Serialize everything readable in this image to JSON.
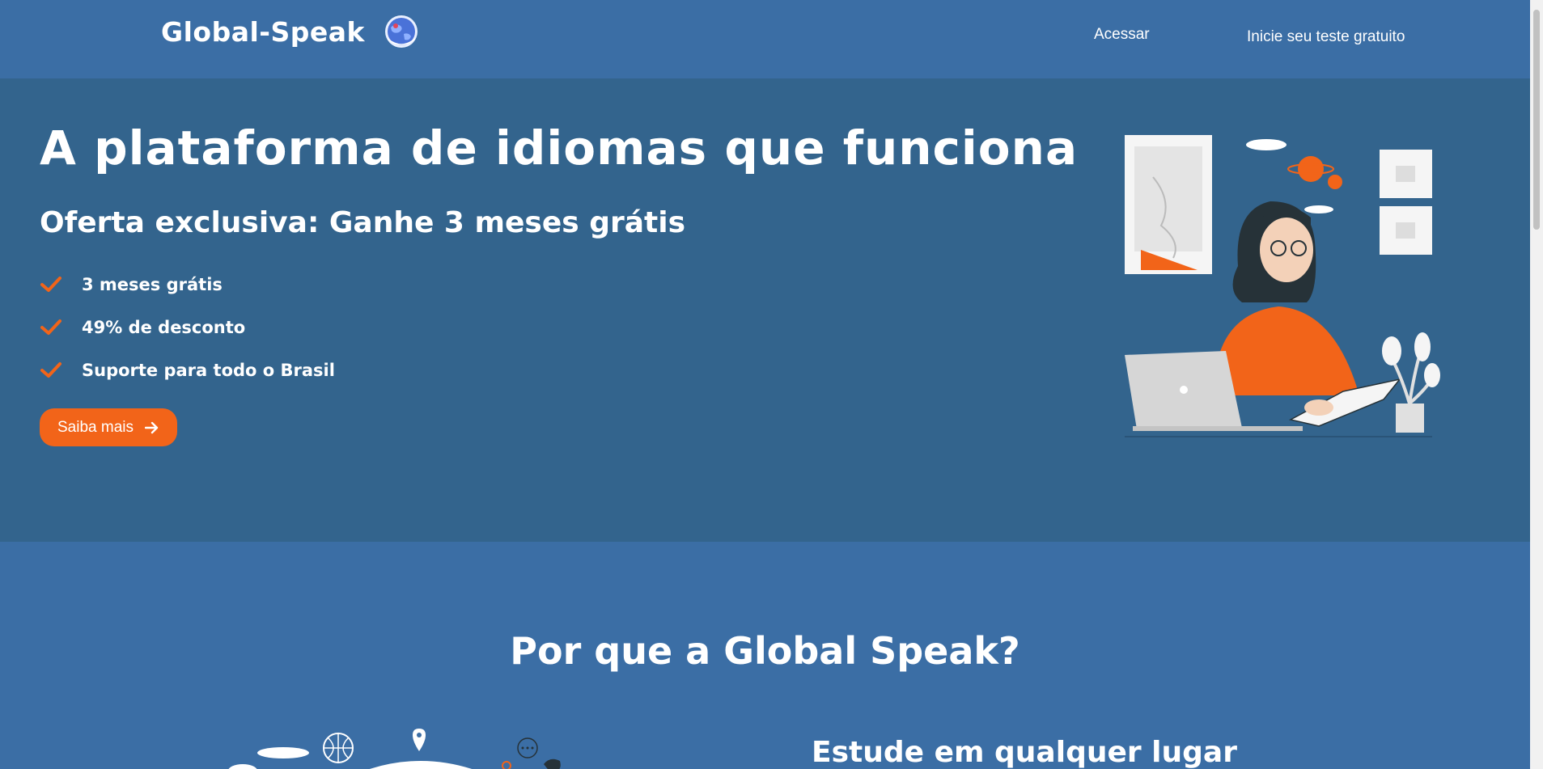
{
  "header": {
    "logo_text": "Global-Speak",
    "login_label": "Acessar",
    "trial_label": "Inicie seu teste gratuito"
  },
  "hero": {
    "title": "A plataforma de idiomas que funciona",
    "subtitle": "Oferta exclusiva: Ganhe 3 meses grátis",
    "benefits": [
      {
        "label": "3 meses grátis",
        "icon": "check-icon"
      },
      {
        "label": "49% de desconto",
        "icon": "check-icon"
      },
      {
        "label": "Suporte para todo o Brasil",
        "icon": "check-icon"
      }
    ],
    "cta_label": "Saiba mais"
  },
  "why": {
    "title": "Por que a Global Speak?",
    "feature_title": "Estude em qualquer lugar"
  },
  "colors": {
    "header_bg": "#3b6ea5",
    "hero_bg": "#33648d",
    "accent": "#f26419"
  }
}
